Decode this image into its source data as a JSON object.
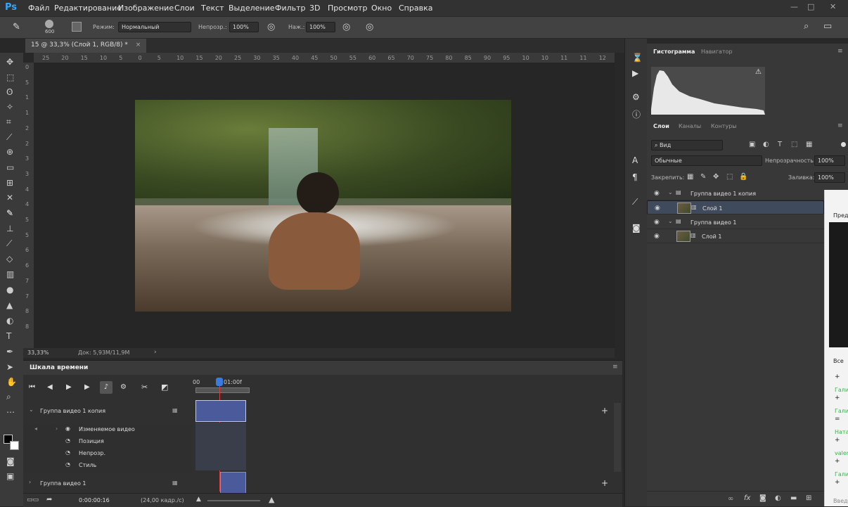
{
  "menubar": {
    "logo": "Ps",
    "items": [
      "Файл",
      "Редактирование",
      "Изображение",
      "Слои",
      "Текст",
      "Выделение",
      "Фильтр",
      "3D",
      "Просмотр",
      "Окно",
      "Справка"
    ],
    "win_controls": [
      "—",
      "□",
      "✕"
    ]
  },
  "options": {
    "brush_size": "600",
    "mode_label": "Режим:",
    "mode_value": "Нормальный",
    "opacity_label": "Непрозр.:",
    "opacity_value": "100%",
    "flow_label": "Наж.:",
    "flow_value": "100%"
  },
  "document": {
    "tab_title": "15 @ 33,3% (Слой 1, RGB/8) *",
    "zoom": "33,33%",
    "doc_info": "Док: 5,93M/11,9M"
  },
  "rulers": {
    "h": [
      "25",
      "20",
      "15",
      "10",
      "5",
      "0",
      "5",
      "10",
      "15",
      "20",
      "25",
      "30",
      "35",
      "40",
      "45",
      "50",
      "55",
      "60",
      "65",
      "70",
      "75",
      "80",
      "85",
      "90",
      "95",
      "10",
      "10",
      "11",
      "11",
      "12"
    ],
    "v": [
      "0",
      "5",
      "1",
      "1",
      "2",
      "2",
      "3",
      "3",
      "4",
      "4",
      "5",
      "5",
      "6",
      "6",
      "7",
      "7",
      "8",
      "8"
    ]
  },
  "timeline": {
    "title": "Шкала времени",
    "time_start": "00",
    "time_marker": "01:00f",
    "timecode": "0:00:00:16",
    "fps": "(24,00 кадр./с)",
    "rows": [
      {
        "label": "Группа видео 1 копия"
      },
      {
        "label": "Изменяемое видео"
      },
      {
        "label": "Позиция"
      },
      {
        "label": "Непрозр."
      },
      {
        "label": "Стиль"
      },
      {
        "label": "Группа видео 1"
      }
    ]
  },
  "histogram": {
    "tabs": [
      "Гистограмма",
      "Навигатор"
    ]
  },
  "layers": {
    "tabs": [
      "Слои",
      "Каналы",
      "Контуры"
    ],
    "filter": "Вид",
    "blend_mode": "Обычные",
    "opacity_label": "Непрозрачность:",
    "opacity_value": "100%",
    "lock_label": "Закрепить:",
    "fill_label": "Заливка:",
    "fill_value": "100%",
    "items": [
      {
        "name": "Группа видео 1 копия",
        "type": "group"
      },
      {
        "name": "Слой 1",
        "type": "layer",
        "selected": true
      },
      {
        "name": "Группа видео 1",
        "type": "group"
      },
      {
        "name": "Слой 1",
        "type": "layer",
        "selected": false
      }
    ]
  },
  "right_panel": {
    "head": "Пред",
    "all": "Все",
    "entries": [
      "Гали",
      "Гали",
      "Ната",
      "valer",
      "Гали"
    ],
    "footer": "Введ"
  }
}
